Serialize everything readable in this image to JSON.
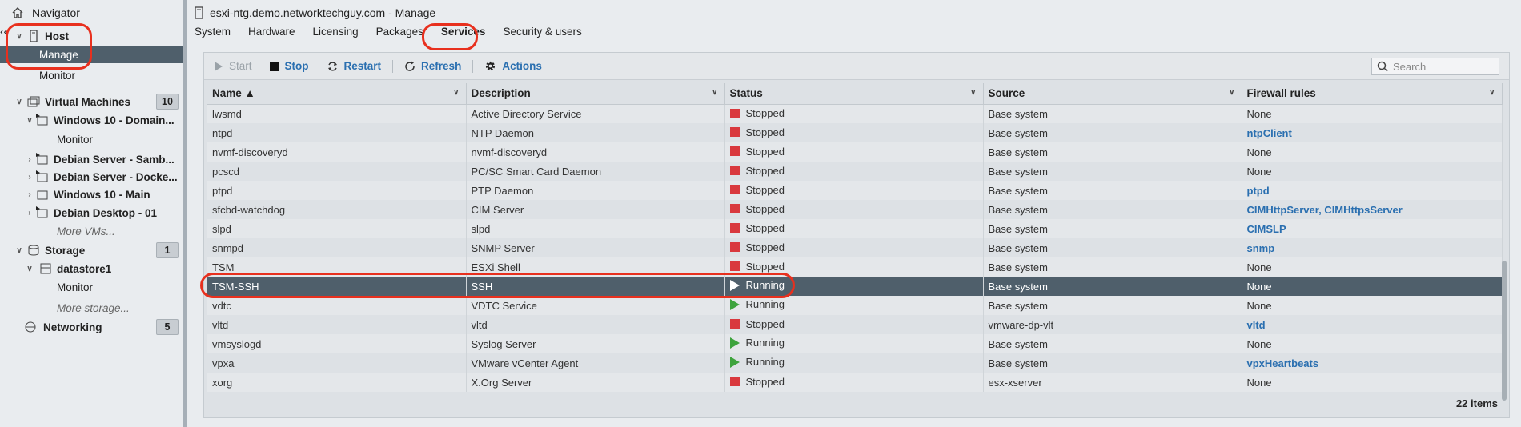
{
  "navigator": {
    "title": "Navigator",
    "host": "Host",
    "manage": "Manage",
    "host_monitor": "Monitor",
    "vms": {
      "label": "Virtual Machines",
      "count": "10"
    },
    "vm_items": [
      "Windows 10 - Domain...",
      "Debian Server - Samb...",
      "Debian Server - Docke...",
      "Windows 10 - Main",
      "Debian Desktop - 01"
    ],
    "vm_monitor": "Monitor",
    "more_vms": "More VMs...",
    "storage": {
      "label": "Storage",
      "count": "1"
    },
    "datastore": "datastore1",
    "ds_monitor": "Monitor",
    "more_storage": "More storage...",
    "networking": {
      "label": "Networking",
      "count": "5"
    }
  },
  "header": {
    "title": "esxi-ntg.demo.networktechguy.com - Manage",
    "tabs": [
      "System",
      "Hardware",
      "Licensing",
      "Packages",
      "Services",
      "Security & users"
    ],
    "active_tab": "Services"
  },
  "toolbar": {
    "start": "Start",
    "stop": "Stop",
    "restart": "Restart",
    "refresh": "Refresh",
    "actions": "Actions",
    "search_placeholder": "Search"
  },
  "columns": [
    "Name ▲",
    "Description",
    "Status",
    "Source",
    "Firewall rules"
  ],
  "rows": [
    {
      "name": "lwsmd",
      "description": "Active Directory Service",
      "status": "Stopped",
      "source": "Base system",
      "firewall": "None",
      "link": false
    },
    {
      "name": "ntpd",
      "description": "NTP Daemon",
      "status": "Stopped",
      "source": "Base system",
      "firewall": "ntpClient",
      "link": true
    },
    {
      "name": "nvmf-discoveryd",
      "description": "nvmf-discoveryd",
      "status": "Stopped",
      "source": "Base system",
      "firewall": "None",
      "link": false
    },
    {
      "name": "pcscd",
      "description": "PC/SC Smart Card Daemon",
      "status": "Stopped",
      "source": "Base system",
      "firewall": "None",
      "link": false
    },
    {
      "name": "ptpd",
      "description": "PTP Daemon",
      "status": "Stopped",
      "source": "Base system",
      "firewall": "ptpd",
      "link": true
    },
    {
      "name": "sfcbd-watchdog",
      "description": "CIM Server",
      "status": "Stopped",
      "source": "Base system",
      "firewall": "CIMHttpServer, CIMHttpsServer",
      "link": true
    },
    {
      "name": "slpd",
      "description": "slpd",
      "status": "Stopped",
      "source": "Base system",
      "firewall": "CIMSLP",
      "link": true
    },
    {
      "name": "snmpd",
      "description": "SNMP Server",
      "status": "Stopped",
      "source": "Base system",
      "firewall": "snmp",
      "link": true
    },
    {
      "name": "TSM",
      "description": "ESXi Shell",
      "status": "Stopped",
      "source": "Base system",
      "firewall": "None",
      "link": false
    },
    {
      "name": "TSM-SSH",
      "description": "SSH",
      "status": "Running",
      "source": "Base system",
      "firewall": "None",
      "link": false,
      "selected": true
    },
    {
      "name": "vdtc",
      "description": "VDTC Service",
      "status": "Running",
      "source": "Base system",
      "firewall": "None",
      "link": false
    },
    {
      "name": "vltd",
      "description": "vltd",
      "status": "Stopped",
      "source": "vmware-dp-vlt",
      "firewall": "vltd",
      "link": true
    },
    {
      "name": "vmsyslogd",
      "description": "Syslog Server",
      "status": "Running",
      "source": "Base system",
      "firewall": "None",
      "link": false
    },
    {
      "name": "vpxa",
      "description": "VMware vCenter Agent",
      "status": "Running",
      "source": "Base system",
      "firewall": "vpxHeartbeats",
      "link": true
    },
    {
      "name": "xorg",
      "description": "X.Org Server",
      "status": "Stopped",
      "source": "esx-xserver",
      "firewall": "None",
      "link": false
    }
  ],
  "footer": {
    "items": "22 items"
  },
  "colors": {
    "accent": "#2a6fb0",
    "stopped": "#d9393e",
    "running": "#3da33d",
    "selected_row": "#4f5f6b",
    "highlight": "#e8301e"
  }
}
